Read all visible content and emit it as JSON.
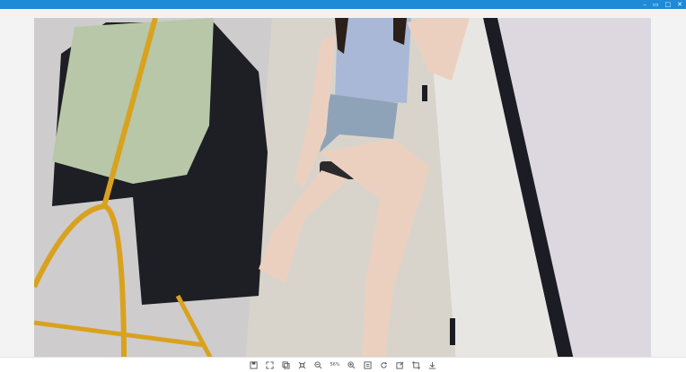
{
  "window": {
    "accent_color": "#1f8ad6",
    "controls": [
      "minimize-icon",
      "restore-icon",
      "maximize-icon",
      "close-icon"
    ],
    "control_glyphs": [
      "–",
      "▭",
      "□",
      "✕"
    ]
  },
  "photo": {
    "description_icon": "photo-image"
  },
  "toolbar": {
    "zoom_label": "56%",
    "buttons": [
      "save-icon",
      "fit-screen-icon",
      "copy-icon",
      "actual-size-icon",
      "zoom-out-icon",
      "zoom-in-icon",
      "info-icon",
      "rotate-icon",
      "edit-icon",
      "crop-icon",
      "download-icon"
    ]
  }
}
